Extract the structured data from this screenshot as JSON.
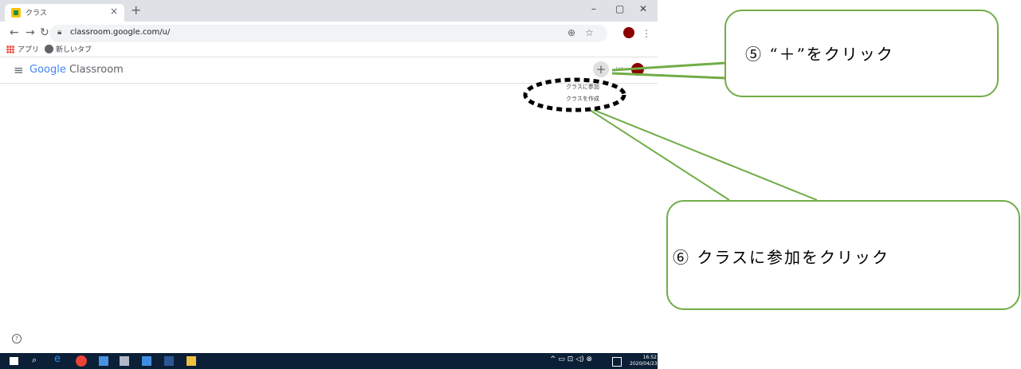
{
  "browser": {
    "tab_title": "クラス",
    "tab_close": "×",
    "new_tab": "+",
    "window_minimize": "–",
    "window_restore": "▢",
    "window_close": "✕",
    "url": "classroom.google.com/u/",
    "bookmarks": [
      "アプリ",
      "新しいタブ"
    ]
  },
  "app": {
    "logo_google": "Google",
    "logo_product": "Classroom",
    "add_button": "+",
    "apps_icon": "⋯",
    "menu_items": [
      "クラスに参加",
      "クラスを作成"
    ],
    "help": "?"
  },
  "taskbar": {
    "time": "16:52",
    "date": "2020/04/23"
  },
  "callouts": {
    "step5": "⑤ “＋”をクリック",
    "step6": "⑥ クラスに参加をクリック"
  },
  "colors": {
    "callout_border": "#71ad47",
    "avatar": "#8b0000",
    "taskbar": "#0b1f36"
  }
}
